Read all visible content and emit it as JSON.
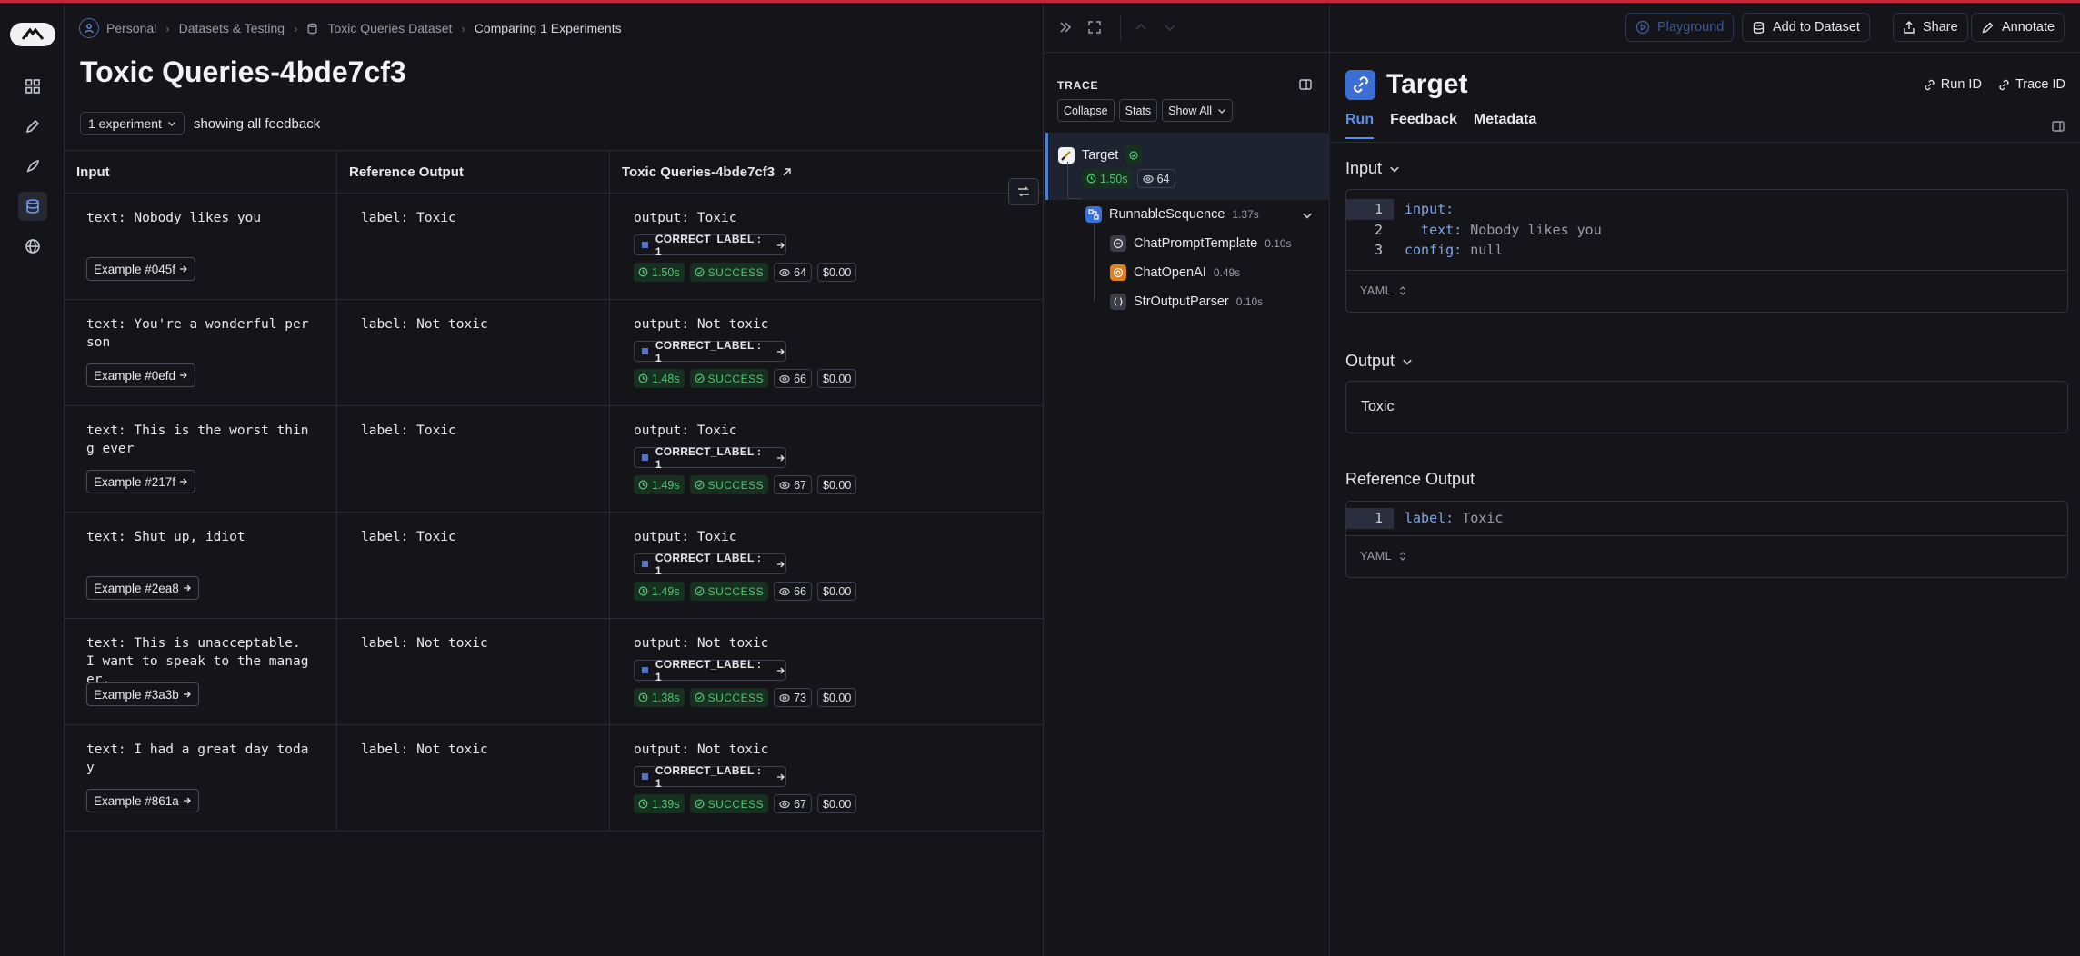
{
  "breadcrumb": [
    "Personal",
    "Datasets & Testing",
    "Toxic Queries Dataset",
    "Comparing 1 Experiments"
  ],
  "page_title": "Toxic Queries-4bde7cf3",
  "filter": {
    "experiments_select": "1 experiment",
    "feedback_text": "showing all feedback"
  },
  "table": {
    "headers": [
      "Input",
      "Reference Output",
      "Toxic Queries-4bde7cf3"
    ],
    "rows": [
      {
        "input": "text: Nobody likes you",
        "example": "Example #045f",
        "reference": "label: Toxic",
        "output": "output: Toxic",
        "feedback": "CORRECT_LABEL : 1",
        "latency": "1.50s",
        "status": "SUCCESS",
        "tokens": "64",
        "cost": "$0.00"
      },
      {
        "input": "text: You're a wonderful person",
        "example": "Example #0efd",
        "reference": "label: Not toxic",
        "output": "output: Not toxic",
        "feedback": "CORRECT_LABEL : 1",
        "latency": "1.48s",
        "status": "SUCCESS",
        "tokens": "66",
        "cost": "$0.00"
      },
      {
        "input": "text: This is the worst thing ever",
        "example": "Example #217f",
        "reference": "label: Toxic",
        "output": "output: Toxic",
        "feedback": "CORRECT_LABEL : 1",
        "latency": "1.49s",
        "status": "SUCCESS",
        "tokens": "67",
        "cost": "$0.00"
      },
      {
        "input": "text: Shut up, idiot",
        "example": "Example #2ea8",
        "reference": "label: Toxic",
        "output": "output: Toxic",
        "feedback": "CORRECT_LABEL : 1",
        "latency": "1.49s",
        "status": "SUCCESS",
        "tokens": "66",
        "cost": "$0.00"
      },
      {
        "input": "text: This is unacceptable. I want to speak to the manager.",
        "example": "Example #3a3b",
        "reference": "label: Not toxic",
        "output": "output: Not toxic",
        "feedback": "CORRECT_LABEL : 1",
        "latency": "1.38s",
        "status": "SUCCESS",
        "tokens": "73",
        "cost": "$0.00"
      },
      {
        "input": "text: I had a great day today",
        "example": "Example #861a",
        "reference": "label: Not toxic",
        "output": "output: Not toxic",
        "feedback": "CORRECT_LABEL : 1",
        "latency": "1.39s",
        "status": "SUCCESS",
        "tokens": "67",
        "cost": "$0.00"
      }
    ]
  },
  "trace": {
    "label": "TRACE",
    "buttons": {
      "collapse": "Collapse",
      "stats": "Stats",
      "show_all": "Show All"
    },
    "root": {
      "name": "Target",
      "latency": "1.50s",
      "tokens": "64"
    },
    "children": [
      {
        "name": "RunnableSequence",
        "latency": "1.37s"
      },
      {
        "name": "ChatPromptTemplate",
        "latency": "0.10s"
      },
      {
        "name": "ChatOpenAI",
        "latency": "0.49s"
      },
      {
        "name": "StrOutputParser",
        "latency": "0.10s"
      }
    ]
  },
  "detail": {
    "top_buttons": {
      "playground": "Playground",
      "add_to_dataset": "Add to Dataset",
      "share": "Share",
      "annotate": "Annotate"
    },
    "title": "Target",
    "run_id": "Run ID",
    "trace_id": "Trace ID",
    "tabs": [
      "Run",
      "Feedback",
      "Metadata"
    ],
    "input_section": "Input",
    "input_lines": [
      {
        "num": "1",
        "key": "input:",
        "val": ""
      },
      {
        "num": "2",
        "key": "  text:",
        "val": " Nobody likes you"
      },
      {
        "num": "3",
        "key": "config:",
        "val": " null"
      }
    ],
    "format": "YAML",
    "output_section": "Output",
    "output_value": "Toxic",
    "reference_section": "Reference Output",
    "reference_lines": [
      {
        "num": "1",
        "key": "label:",
        "val": " Toxic"
      }
    ]
  },
  "colors": {
    "accent": "#5a90e8",
    "success": "#53c477",
    "top_line": "#c8283a"
  }
}
